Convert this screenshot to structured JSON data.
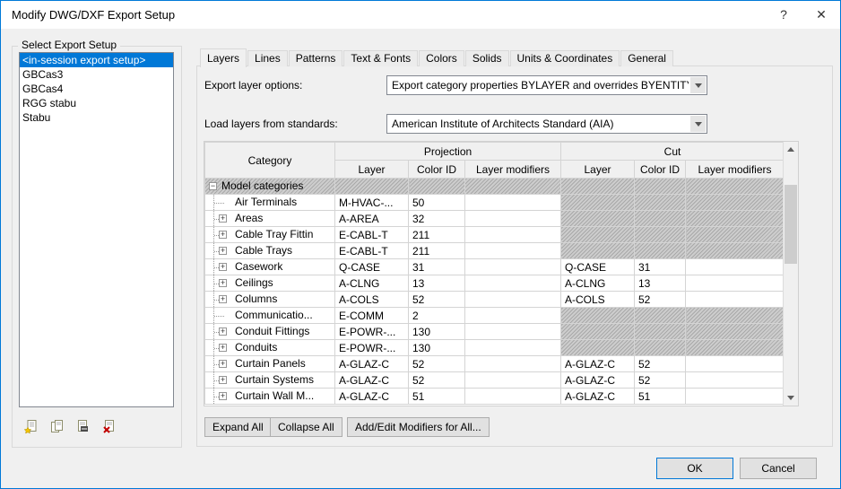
{
  "window": {
    "title": "Modify DWG/DXF Export Setup",
    "help_label": "?",
    "close_label": "✕"
  },
  "colors": {
    "selection": "#0078d7",
    "default_button_border": "#0078d7",
    "hatch_dark": "#a9a9a9",
    "hatch_light": "#cdcdcd"
  },
  "export_setup": {
    "label": "Select Export Setup",
    "items": [
      {
        "label": "<in-session export setup>",
        "selected": true
      },
      {
        "label": "GBCas3",
        "selected": false
      },
      {
        "label": "GBCas4",
        "selected": false
      },
      {
        "label": "RGG stabu",
        "selected": false
      },
      {
        "label": "Stabu",
        "selected": false
      }
    ],
    "toolbar": [
      {
        "name": "new-export-setup"
      },
      {
        "name": "duplicate-export-setup"
      },
      {
        "name": "rename-export-setup"
      },
      {
        "name": "delete-export-setup"
      }
    ]
  },
  "tabs": [
    {
      "label": "Layers",
      "active": true
    },
    {
      "label": "Lines",
      "active": false
    },
    {
      "label": "Patterns",
      "active": false
    },
    {
      "label": "Text & Fonts",
      "active": false
    },
    {
      "label": "Colors",
      "active": false
    },
    {
      "label": "Solids",
      "active": false
    },
    {
      "label": "Units & Coordinates",
      "active": false
    },
    {
      "label": "General",
      "active": false
    }
  ],
  "options": {
    "export_layer_label": "Export layer options:",
    "export_layer_value": "Export category properties BYLAYER and overrides BYENTITY",
    "load_layers_label": "Load layers from standards:",
    "load_layers_value": "American Institute of Architects Standard (AIA)"
  },
  "table": {
    "headers": {
      "category": "Category",
      "projection": "Projection",
      "cut": "Cut",
      "sub": [
        "Layer",
        "Color ID",
        "Layer modifiers"
      ]
    },
    "rows": [
      {
        "category": "Model categories",
        "level": 0,
        "expand": "minus",
        "group": true
      },
      {
        "category": "Air Terminals",
        "level": 1,
        "expand": "none",
        "proj": {
          "layer": "M-HVAC-...",
          "color": "50"
        },
        "cut_hatched": true
      },
      {
        "category": "Areas",
        "level": 1,
        "expand": "plus",
        "proj": {
          "layer": "A-AREA",
          "color": "32"
        },
        "cut_hatched": true
      },
      {
        "category": "Cable Tray Fittin",
        "level": 1,
        "expand": "plus",
        "proj": {
          "layer": "E-CABL-T",
          "color": "211"
        },
        "cut_hatched": true
      },
      {
        "category": "Cable Trays",
        "level": 1,
        "expand": "plus",
        "proj": {
          "layer": "E-CABL-T",
          "color": "211"
        },
        "cut_hatched": true
      },
      {
        "category": "Casework",
        "level": 1,
        "expand": "plus",
        "proj": {
          "layer": "Q-CASE",
          "color": "31"
        },
        "cut": {
          "layer": "Q-CASE",
          "color": "31"
        }
      },
      {
        "category": "Ceilings",
        "level": 1,
        "expand": "plus",
        "proj": {
          "layer": "A-CLNG",
          "color": "13"
        },
        "cut": {
          "layer": "A-CLNG",
          "color": "13"
        }
      },
      {
        "category": "Columns",
        "level": 1,
        "expand": "plus",
        "proj": {
          "layer": "A-COLS",
          "color": "52"
        },
        "cut": {
          "layer": "A-COLS",
          "color": "52"
        }
      },
      {
        "category": "Communicatio...",
        "level": 1,
        "expand": "none",
        "proj": {
          "layer": "E-COMM",
          "color": "2"
        },
        "cut_hatched": true
      },
      {
        "category": "Conduit Fittings",
        "level": 1,
        "expand": "plus",
        "proj": {
          "layer": "E-POWR-...",
          "color": "130"
        },
        "cut_hatched": true
      },
      {
        "category": "Conduits",
        "level": 1,
        "expand": "plus",
        "proj": {
          "layer": "E-POWR-...",
          "color": "130"
        },
        "cut_hatched": true
      },
      {
        "category": "Curtain Panels",
        "level": 1,
        "expand": "plus",
        "proj": {
          "layer": "A-GLAZ-C",
          "color": "52"
        },
        "cut": {
          "layer": "A-GLAZ-C",
          "color": "52"
        }
      },
      {
        "category": "Curtain Systems",
        "level": 1,
        "expand": "plus",
        "proj": {
          "layer": "A-GLAZ-C",
          "color": "52"
        },
        "cut": {
          "layer": "A-GLAZ-C",
          "color": "52"
        }
      },
      {
        "category": "Curtain Wall M...",
        "level": 1,
        "expand": "plus",
        "proj": {
          "layer": "A-GLAZ-C",
          "color": "51"
        },
        "cut": {
          "layer": "A-GLAZ-C",
          "color": "51"
        }
      }
    ]
  },
  "actions": {
    "expand_all": "Expand All",
    "collapse_all": "Collapse All",
    "add_edit_modifiers": "Add/Edit Modifiers for All..."
  },
  "footer": {
    "ok": "OK",
    "cancel": "Cancel"
  }
}
